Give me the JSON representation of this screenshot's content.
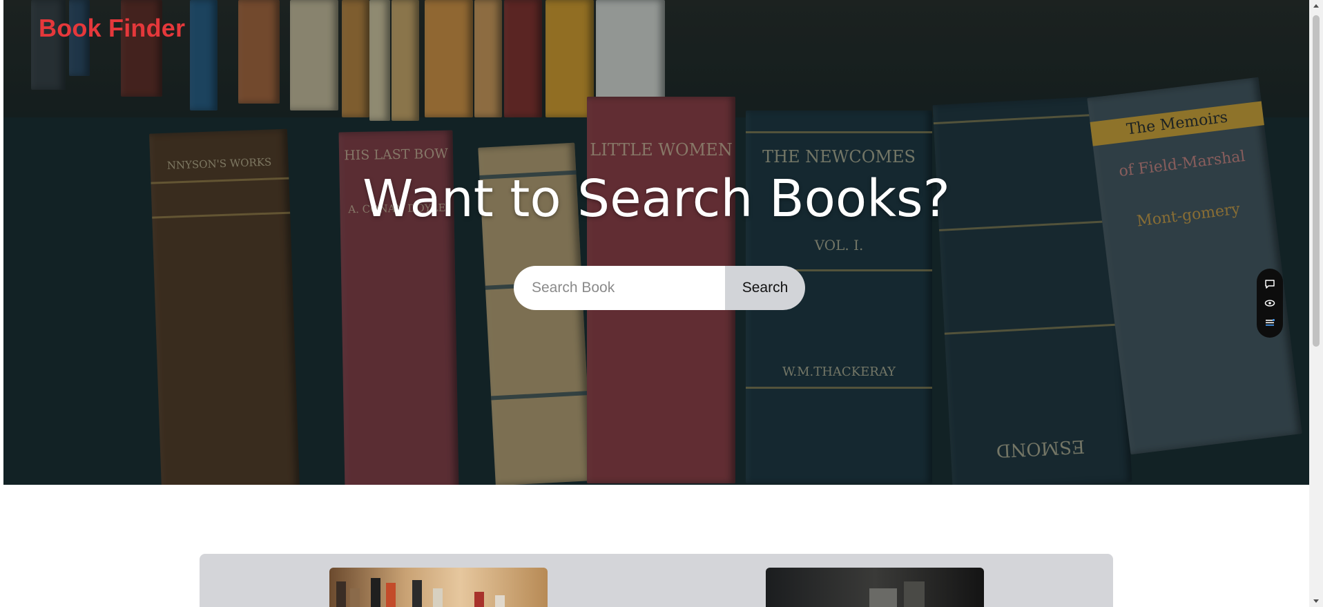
{
  "brand": {
    "name": "Book Finder",
    "color": "#e5383b"
  },
  "hero": {
    "headline": "Want to Search Books?",
    "spines": {
      "tennyson": "NNYSON'S WORKS",
      "his_last_bow": "HIS LAST BOW",
      "doyle": "A. CONAN DOYLE",
      "little_women": "LITTLE WOMEN",
      "newcomes": "THE NEWCOMES",
      "vol": "VOL. I.",
      "thackeray": "W.M.THACKERAY",
      "esmond": "ESMOND",
      "memoirs": "The Memoirs",
      "field_marshal": "of Field-Marshal",
      "montgomery": "Mont-gomery"
    }
  },
  "search": {
    "placeholder": "Search Book",
    "button_label": "Search"
  },
  "float_widget": {
    "icons": [
      "chat-icon",
      "eye-icon",
      "menu-icon"
    ]
  },
  "gallery": {
    "background": "#d4d5d9"
  }
}
